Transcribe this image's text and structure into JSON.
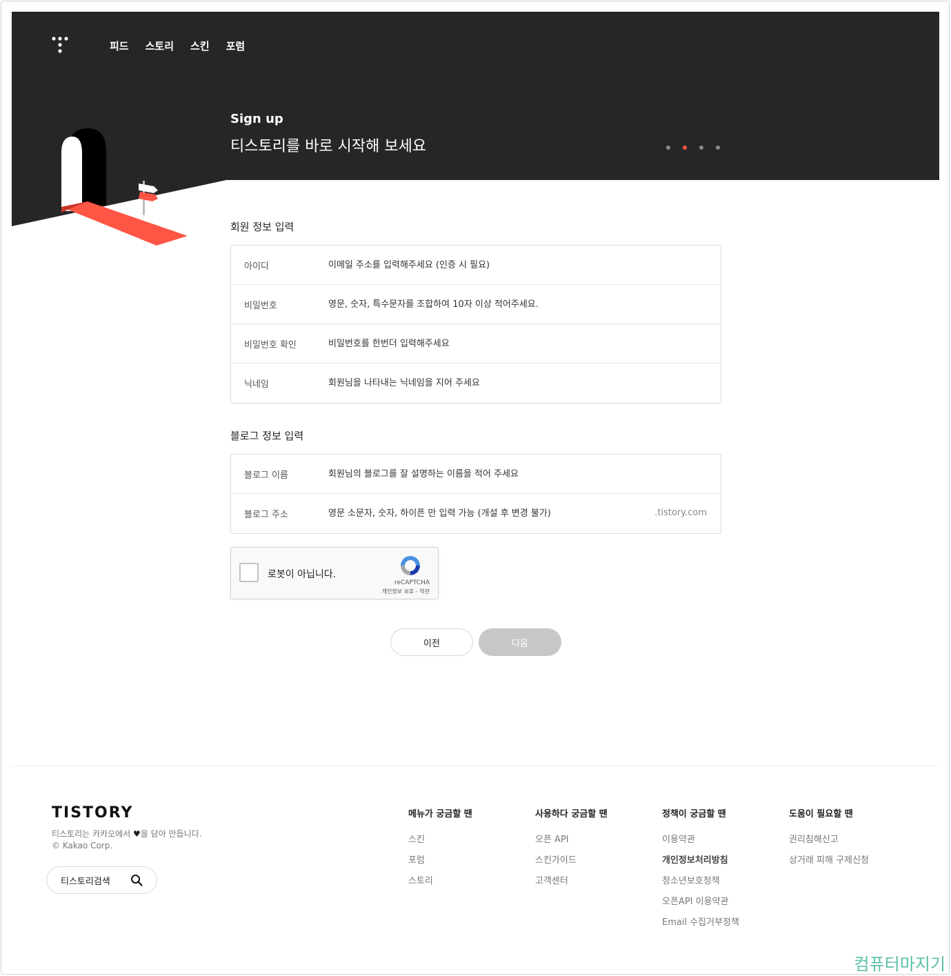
{
  "nav": {
    "items": [
      "피드",
      "스토리",
      "스킨",
      "포럼"
    ]
  },
  "hero": {
    "kicker": "Sign up",
    "title": "티스토리를 바로 시작해 보세요",
    "step_count": 4,
    "active_step": 2,
    "colors": {
      "background": "#262626",
      "accent": "#ff5544"
    }
  },
  "member": {
    "title": "회원 정보 입력",
    "fields": [
      {
        "label": "아이디",
        "placeholder": "이메일 주소를 입력해주세요 (인증 시 필요)"
      },
      {
        "label": "비밀번호",
        "placeholder": "영문, 숫자, 특수문자를 조합하여 10자 이상 적어주세요."
      },
      {
        "label": "비밀번호 확인",
        "placeholder": "비밀번호를 한번더 입력해주세요"
      },
      {
        "label": "닉네임",
        "placeholder": "회원님을 나타내는 닉네임을 지어 주세요"
      }
    ]
  },
  "blog": {
    "title": "블로그 정보 입력",
    "fields": [
      {
        "label": "블로그 이름",
        "placeholder": "회원님의 블로그를 잘 설명하는 이름을 적어 주세요"
      },
      {
        "label": "블로그 주소",
        "placeholder": "영문 소문자, 숫자, 하이픈 만 입력 가능 (개설 후 변경 불가)",
        "suffix": ".tistory.com"
      }
    ]
  },
  "captcha": {
    "label": "로봇이 아닙니다.",
    "brand": "reCAPTCHA",
    "links": "개인정보 보호 - 약관"
  },
  "buttons": {
    "prev": "이전",
    "next": "다음"
  },
  "footer": {
    "logo": "TISTORY",
    "desc_before": "티스토리는 카카오에서 ",
    "desc_heart": "♥",
    "desc_after": "을 담아 만듭니다.",
    "copyright": "© Kakao Corp.",
    "search_label": "티스토리검색",
    "columns": [
      {
        "title": "메뉴가 궁금할 땐",
        "links": [
          "스킨",
          "포럼",
          "스토리"
        ]
      },
      {
        "title": "사용하다 궁금할 땐",
        "links": [
          "오픈 API",
          "스킨가이드",
          "고객센터"
        ]
      },
      {
        "title": "정책이 궁금할 땐",
        "links": [
          "이용약관",
          "개인정보처리방침",
          "청소년보호정책",
          "오픈API 이용약관",
          "Email 수집거부정책"
        ]
      },
      {
        "title": "도움이 필요할 땐",
        "links": [
          "권리침해신고",
          "상거래 피해 구제신청"
        ]
      }
    ]
  },
  "watermark": "컴퓨터마지기"
}
